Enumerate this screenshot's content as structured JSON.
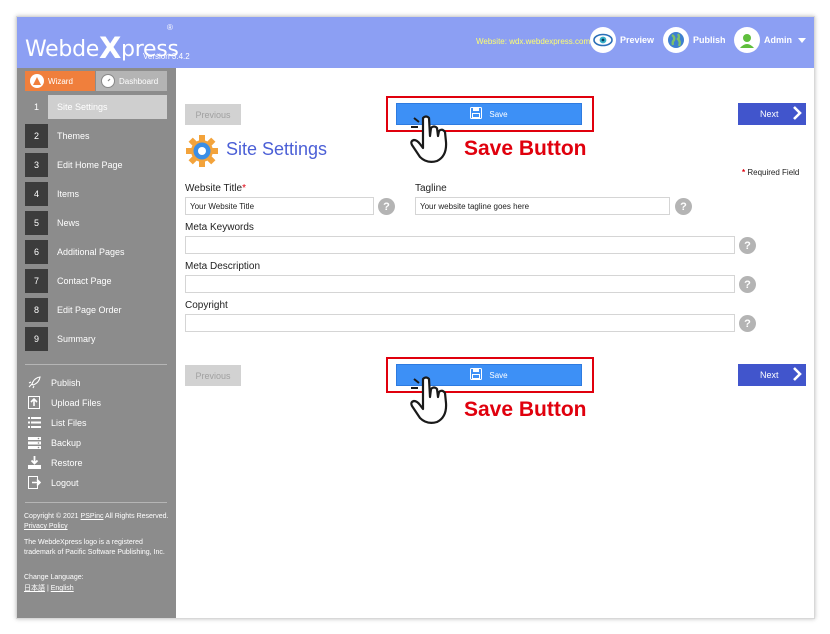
{
  "header": {
    "logo_part1": "Webde",
    "logo_x": "X",
    "logo_part2": "press",
    "registered": "®",
    "version": "Version 3.4.2",
    "website": "Website: wdx.webdexpress.com",
    "preview": "Preview",
    "publish": "Publish",
    "admin": "Admin"
  },
  "sidebar": {
    "wizard_tab": "Wizard",
    "dashboard_tab": "Dashboard",
    "steps": [
      {
        "num": "1",
        "label": "Site Settings"
      },
      {
        "num": "2",
        "label": "Themes"
      },
      {
        "num": "3",
        "label": "Edit Home Page"
      },
      {
        "num": "4",
        "label": "Items"
      },
      {
        "num": "5",
        "label": "News"
      },
      {
        "num": "6",
        "label": "Additional Pages"
      },
      {
        "num": "7",
        "label": "Contact Page"
      },
      {
        "num": "8",
        "label": "Edit Page Order"
      },
      {
        "num": "9",
        "label": "Summary"
      }
    ],
    "tools": [
      {
        "label": "Publish",
        "icon": "rocket-icon"
      },
      {
        "label": "Upload Files",
        "icon": "upload-icon"
      },
      {
        "label": "List Files",
        "icon": "list-icon"
      },
      {
        "label": "Backup",
        "icon": "backup-icon"
      },
      {
        "label": "Restore",
        "icon": "restore-icon"
      },
      {
        "label": "Logout",
        "icon": "logout-icon"
      }
    ],
    "copyright_prefix": "Copyright © 2021 ",
    "copyright_company": "PSPinc",
    "copyright_rights": " All Rights Reserved. ",
    "privacy": "Privacy Policy",
    "trademark": "The WebdeXpress logo is a registered trademark of Pacific Software Publishing, Inc.",
    "change_language": "Change Language:",
    "lang_jp": "日本語",
    "lang_sep": "|",
    "lang_en": "English"
  },
  "main": {
    "previous": "Previous",
    "save": "Save",
    "next": "Next",
    "callout": "Save Button",
    "page_title": "Site Settings",
    "required_star": "*",
    "required_field": " Required Field",
    "website_title_label": "Website Title",
    "website_title_value": "Your Website Title",
    "tagline_label": "Tagline",
    "tagline_value": "Your website tagline goes here",
    "meta_keywords_label": "Meta Keywords",
    "meta_keywords_value": "",
    "meta_description_label": "Meta Description",
    "meta_description_value": "",
    "copyright_label": "Copyright",
    "copyright_value": "",
    "help": "?"
  },
  "colors": {
    "header_bg": "#8c9ff3",
    "sidebar_bg": "#8c8c8c",
    "save_blue": "#3d90f6",
    "next_blue": "#4155cc",
    "title_blue": "#4b5fd6",
    "wizard_orange": "#f07f3c",
    "callout_red": "#e0000d"
  }
}
